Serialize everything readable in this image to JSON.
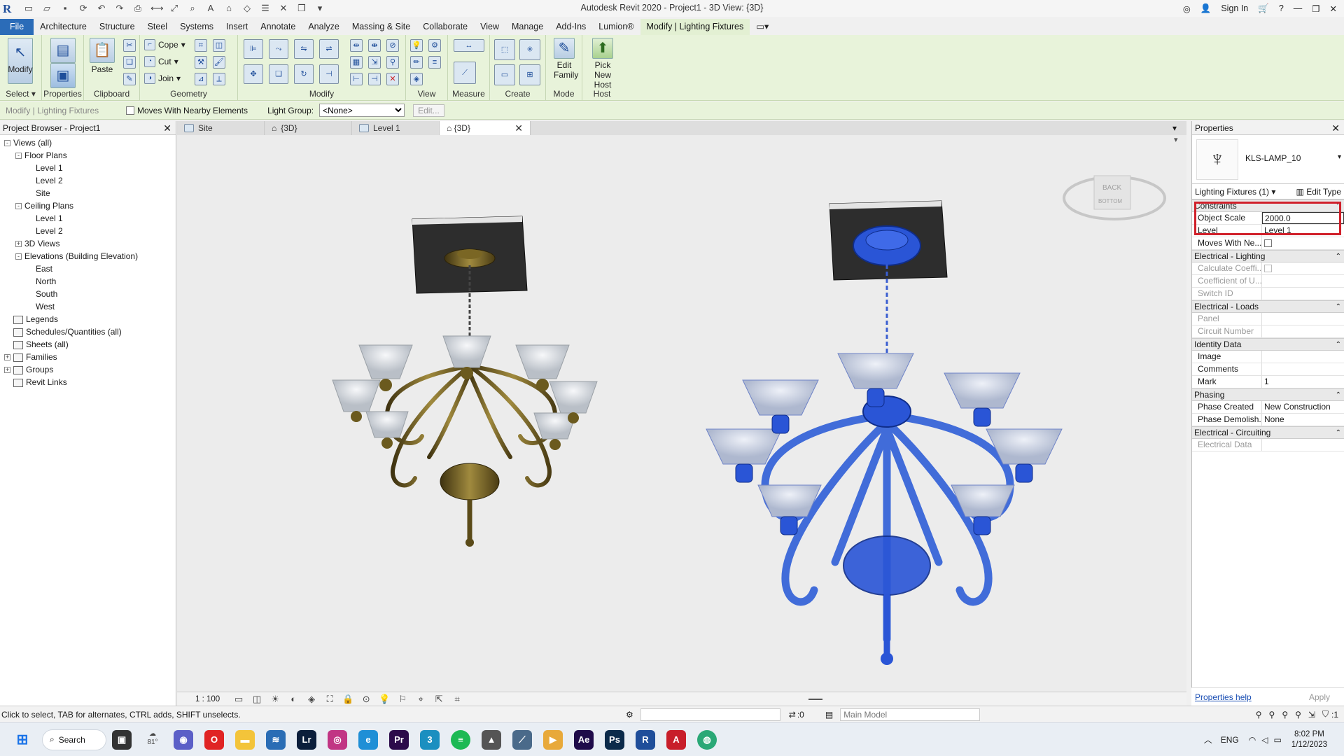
{
  "window": {
    "title": "Autodesk Revit 2020 - Project1 - 3D View: {3D}",
    "sign_in": "Sign In"
  },
  "menu": {
    "tabs": [
      "File",
      "Architecture",
      "Structure",
      "Steel",
      "Systems",
      "Insert",
      "Annotate",
      "Analyze",
      "Massing & Site",
      "Collaborate",
      "View",
      "Manage",
      "Add-Ins",
      "Lumion®",
      "Modify | Lighting Fixtures"
    ]
  },
  "ribbon": {
    "select": {
      "modify": "Modify",
      "label": "Select"
    },
    "properties": {
      "label": "Properties"
    },
    "clipboard": {
      "paste": "Paste",
      "label": "Clipboard"
    },
    "geometry": {
      "cope": "Cope",
      "cut": "Cut",
      "join": "Join",
      "label": "Geometry"
    },
    "modify": {
      "label": "Modify"
    },
    "view": {
      "label": "View"
    },
    "measure": {
      "label": "Measure"
    },
    "create": {
      "label": "Create"
    },
    "mode": {
      "edit_family": "Edit Family",
      "label": "Mode"
    },
    "host": {
      "pick_new_host": "Pick New Host",
      "label": "Host"
    }
  },
  "options_bar": {
    "context": "Modify | Lighting Fixtures",
    "moves_with": "Moves With Nearby Elements",
    "light_group_label": "Light Group:",
    "light_group_value": "<None>",
    "edit": "Edit..."
  },
  "project_browser": {
    "title": "Project Browser - Project1",
    "nodes": [
      {
        "label": "Views (all)",
        "level": 0,
        "toggle": "-"
      },
      {
        "label": "Floor Plans",
        "level": 1,
        "toggle": "-"
      },
      {
        "label": "Level 1",
        "level": 2
      },
      {
        "label": "Level 2",
        "level": 2
      },
      {
        "label": "Site",
        "level": 2
      },
      {
        "label": "Ceiling Plans",
        "level": 1,
        "toggle": "-"
      },
      {
        "label": "Level 1",
        "level": 2
      },
      {
        "label": "Level 2",
        "level": 2
      },
      {
        "label": "3D Views",
        "level": 1,
        "toggle": "+"
      },
      {
        "label": "Elevations (Building Elevation)",
        "level": 1,
        "toggle": "-"
      },
      {
        "label": "East",
        "level": 2
      },
      {
        "label": "North",
        "level": 2
      },
      {
        "label": "South",
        "level": 2
      },
      {
        "label": "West",
        "level": 2
      },
      {
        "label": "Legends",
        "level": 0,
        "icon": true
      },
      {
        "label": "Schedules/Quantities (all)",
        "level": 0,
        "icon": true
      },
      {
        "label": "Sheets (all)",
        "level": 0,
        "icon": true
      },
      {
        "label": "Families",
        "level": 0,
        "toggle": "+",
        "icon": true
      },
      {
        "label": "Groups",
        "level": 0,
        "toggle": "+",
        "icon": true
      },
      {
        "label": "Revit Links",
        "level": 0,
        "icon": true
      }
    ]
  },
  "view_tabs": [
    "Site",
    "{3D}",
    "Level 1",
    "{3D}"
  ],
  "viewcube": {
    "back": "BACK",
    "bottom": "BOTTOM"
  },
  "view_controls": {
    "scale": "1 : 100"
  },
  "properties": {
    "title": "Properties",
    "type_name": "KLS-LAMP_10",
    "filter": "Lighting Fixtures (1)",
    "edit_type": "Edit Type",
    "groups": [
      {
        "name": "Constraints",
        "rows": [
          {
            "k": "Object Scale",
            "v": "2000.0"
          },
          {
            "k": "Level",
            "v": "Level 1"
          },
          {
            "k": "Moves With Ne...",
            "v": "",
            "check": true
          }
        ]
      },
      {
        "name": "Electrical - Lighting",
        "rows": [
          {
            "k": "Calculate Coeffi...",
            "v": "",
            "check": true,
            "dis": true
          },
          {
            "k": "Coefficient of U...",
            "v": "",
            "dis": true
          },
          {
            "k": "Switch ID",
            "v": "",
            "dis": true
          }
        ]
      },
      {
        "name": "Electrical - Loads",
        "rows": [
          {
            "k": "Panel",
            "v": "",
            "dis": true
          },
          {
            "k": "Circuit Number",
            "v": "",
            "dis": true
          }
        ]
      },
      {
        "name": "Identity Data",
        "rows": [
          {
            "k": "Image",
            "v": ""
          },
          {
            "k": "Comments",
            "v": ""
          },
          {
            "k": "Mark",
            "v": "1"
          }
        ]
      },
      {
        "name": "Phasing",
        "rows": [
          {
            "k": "Phase Created",
            "v": "New Construction"
          },
          {
            "k": "Phase Demolish...",
            "v": "None"
          }
        ]
      },
      {
        "name": "Electrical - Circuiting",
        "rows": [
          {
            "k": "Electrical Data",
            "v": "",
            "dis": true
          }
        ]
      }
    ],
    "help": "Properties help",
    "apply": "Apply"
  },
  "status": {
    "hint": "Click to select, TAB for alternates, CTRL adds, SHIFT unselects.",
    "zero": ":0",
    "model": "Main Model",
    "filter_count": ":1"
  },
  "taskbar": {
    "search": "Search",
    "weather": "81°",
    "lang": "ENG",
    "time": "8:02 PM",
    "date": "1/12/2023"
  },
  "colors": {
    "accent": "#2b6cb8",
    "context_tab": "#e3f0d3",
    "ribbon": "#e8f3da",
    "highlight": "#d0202a",
    "brass": "#6b5a1e",
    "selected": "#2a55d6"
  }
}
